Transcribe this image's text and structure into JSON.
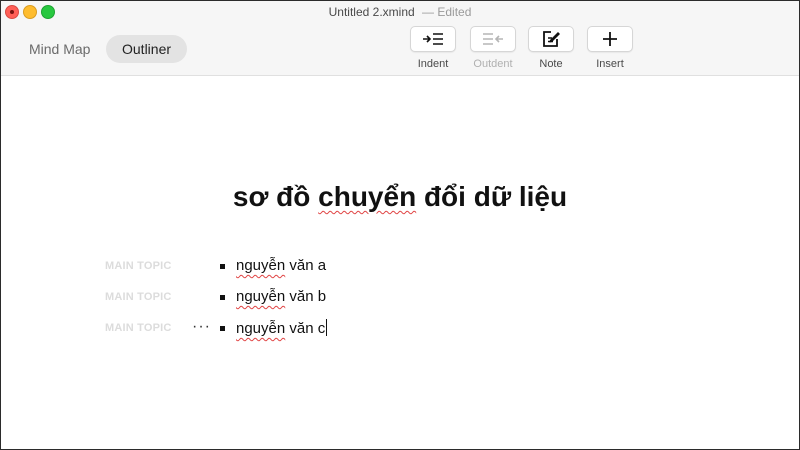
{
  "window": {
    "title": "Untitled 2.xmind",
    "status": "— Edited"
  },
  "views": {
    "mind_map": "Mind Map",
    "outliner": "Outliner",
    "active": "Outliner"
  },
  "toolbar": {
    "indent": {
      "label": "Indent",
      "icon": "indent-icon",
      "enabled": true
    },
    "outdent": {
      "label": "Outdent",
      "icon": "outdent-icon",
      "enabled": false
    },
    "note": {
      "label": "Note",
      "icon": "note-icon",
      "enabled": true
    },
    "insert": {
      "label": "Insert",
      "icon": "plus-icon",
      "enabled": true
    }
  },
  "outline": {
    "central_topic": {
      "before": "sơ đồ ",
      "misspelled": "chuyển",
      "after": " đổi dữ liệu"
    },
    "topic_tag": "MAIN TOPIC",
    "items": [
      {
        "misspelled": "nguyễn",
        "rest": " văn a"
      },
      {
        "misspelled": "nguyễn",
        "rest": " văn b"
      },
      {
        "misspelled": "nguyễn",
        "rest": " văn c"
      }
    ],
    "more_glyph": "···"
  },
  "colors": {
    "spellcheck": "#e04343",
    "tab_active_bg": "#e3e3e3",
    "tag_text": "#dcdcdc"
  }
}
